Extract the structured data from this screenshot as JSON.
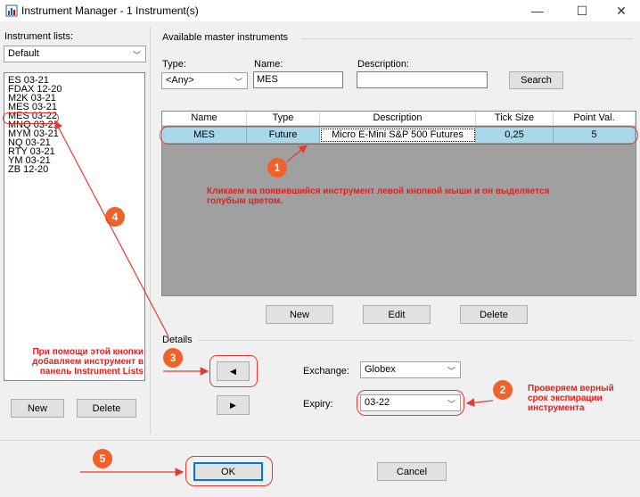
{
  "window": {
    "title": "Instrument Manager - 1 Instrument(s)",
    "minimize": "—",
    "maximize": "☐",
    "close": "✕"
  },
  "left": {
    "lists_label": "Instrument lists:",
    "list_select": "Default",
    "instruments": [
      "ES 03-21",
      "FDAX 12-20",
      "M2K 03-21",
      "MES 03-21",
      "MES 03-22",
      "MNQ 03-21",
      "MYM 03-21",
      "NQ 03-21",
      "RTY 03-21",
      "YM 03-21",
      "ZB 12-20"
    ],
    "new_button": "New",
    "delete_button": "Delete"
  },
  "master": {
    "group_label": "Available master instruments",
    "type_label": "Type:",
    "type_value": "<Any>",
    "name_label": "Name:",
    "name_value": "MES",
    "description_label": "Description:",
    "description_value": "",
    "search_button": "Search",
    "columns": [
      "Name",
      "Type",
      "Description",
      "Tick Size",
      "Point Val."
    ],
    "rows": [
      [
        "MES",
        "Future",
        "Micro E-Mini S&P 500 Futures",
        "0,25",
        "5"
      ]
    ],
    "new_button": "New",
    "edit_button": "Edit",
    "delete_button": "Delete"
  },
  "details": {
    "group_label": "Details",
    "add_arrow": "◀",
    "remove_arrow": "▶",
    "exchange_label": "Exchange:",
    "exchange_value": "Globex",
    "expiry_label": "Expiry:",
    "expiry_value": "03-22"
  },
  "footer": {
    "ok_button": "OK",
    "cancel_button": "Cancel"
  },
  "annotations": {
    "badge1": "1",
    "badge2": "2",
    "badge3": "3",
    "badge4": "4",
    "badge5": "5",
    "note1": "Кликаем на появившийся инструмент левой кнопкой мыши и он выделяется голубым цветом.",
    "note2": "Проверяем верный срок экспирации инструмента",
    "note3": "При помощи этой кнопки добавляем инструмент в панель Instrument Lists",
    "color": "#e02020"
  }
}
